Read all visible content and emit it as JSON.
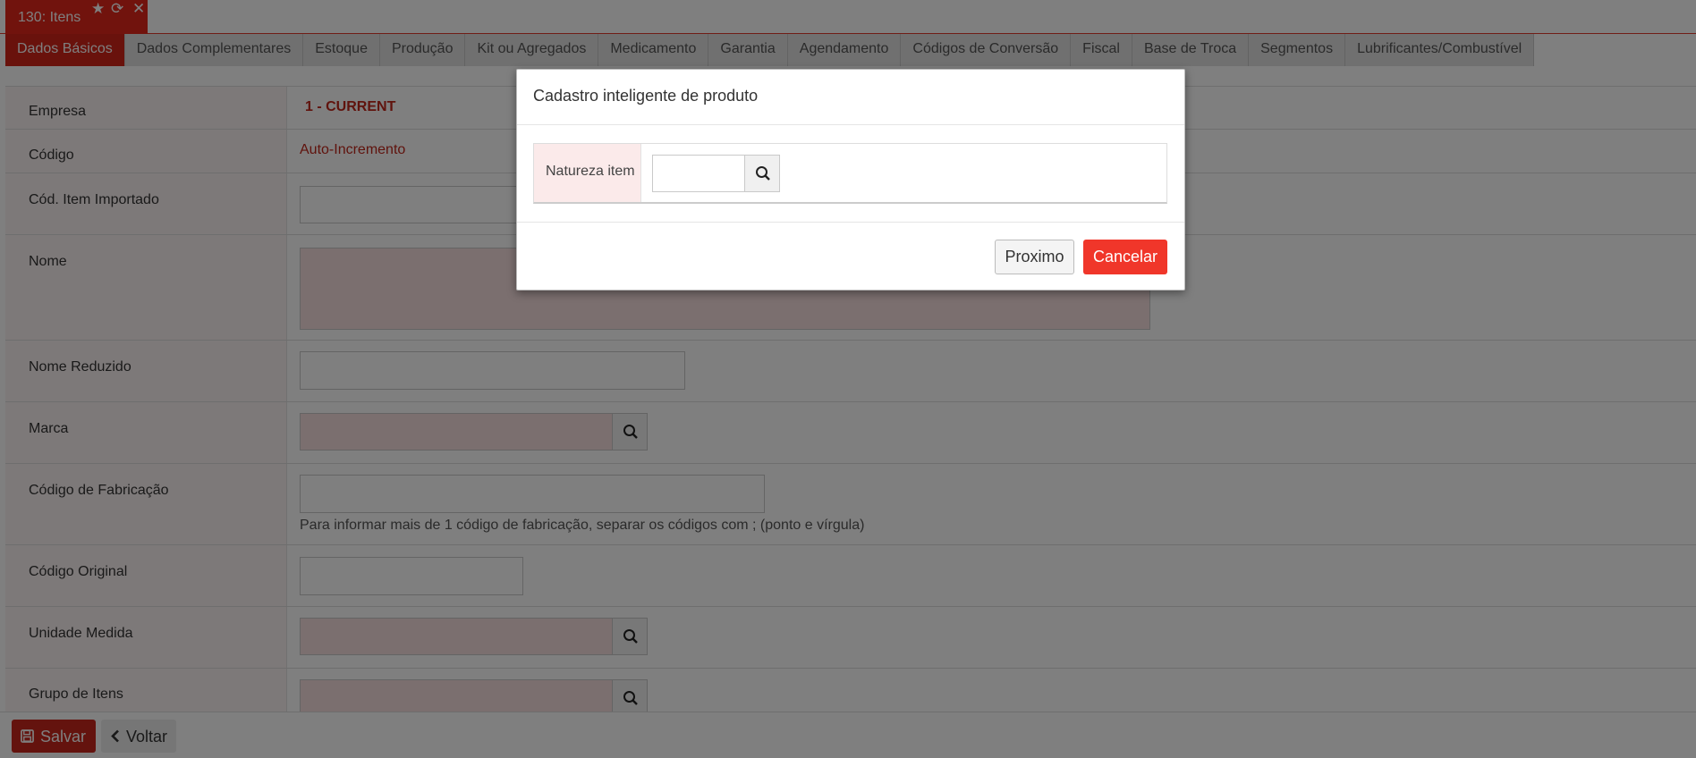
{
  "window_tab": {
    "title": "130: Itens",
    "icons": [
      "star-icon",
      "refresh-icon",
      "close-icon"
    ]
  },
  "tabs": [
    "Dados Básicos",
    "Dados Complementares",
    "Estoque",
    "Produção",
    "Kit ou Agregados",
    "Medicamento",
    "Garantia",
    "Agendamento",
    "Códigos de Conversão",
    "Fiscal",
    "Base de Troca",
    "Segmentos",
    "Lubrificantes/Combustível"
  ],
  "form": {
    "empresa_label": "Empresa",
    "empresa_value": "1 - CURRENT",
    "codigo_label": "Código",
    "codigo_value": "Auto-Incremento",
    "cod_item_importado_label": "Cód. Item Importado",
    "nome_label": "Nome",
    "nome_reduzido_label": "Nome Reduzido",
    "marca_label": "Marca",
    "codigo_fabricacao_label": "Código de Fabricação",
    "codigo_fabricacao_help": "Para informar mais de 1 código de fabricação, separar os códigos com ; (ponto e vírgula)",
    "codigo_original_label": "Código Original",
    "unidade_medida_label": "Unidade Medida",
    "grupo_itens_label": "Grupo de Itens"
  },
  "bottom": {
    "salvar_label": "Salvar",
    "voltar_label": "Voltar"
  },
  "modal": {
    "title": "Cadastro inteligente de produto",
    "field_label": "Natureza item",
    "field_value": "",
    "next_label": "Proximo",
    "cancel_label": "Cancelar"
  },
  "colors": {
    "brand_red": "#e3261b",
    "cancel_red": "#f0362a",
    "overlay": "rgba(0,0,0,0.5)"
  }
}
